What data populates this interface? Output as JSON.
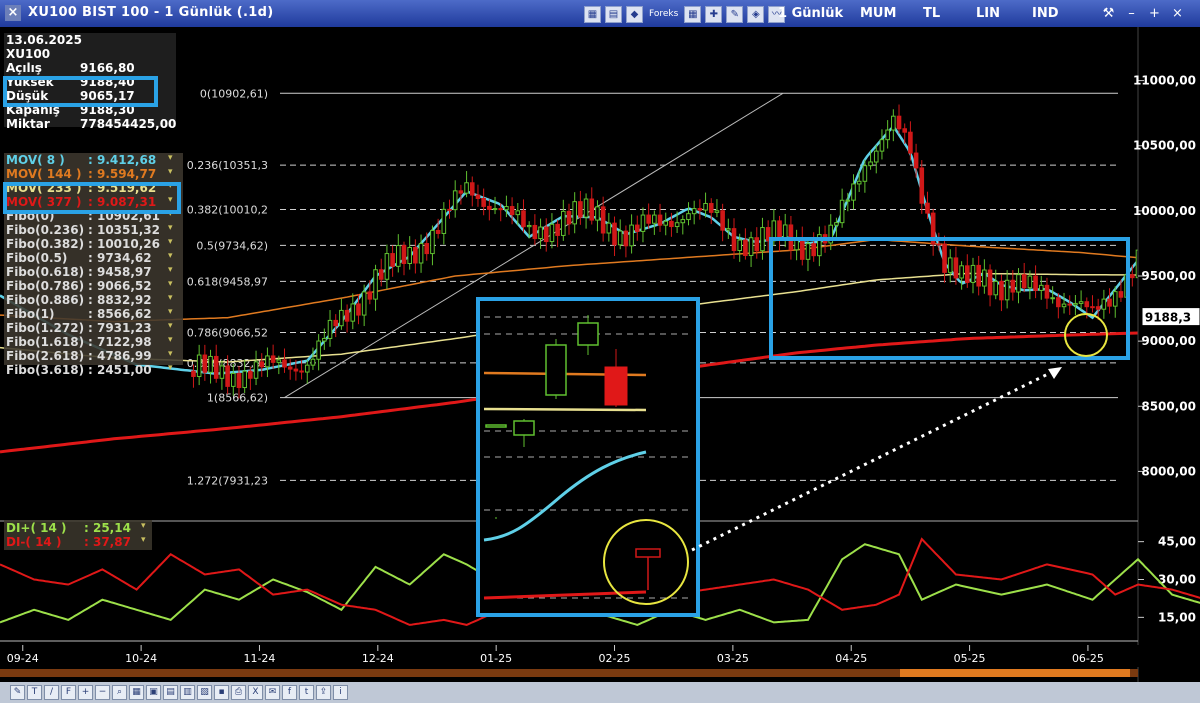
{
  "window": {
    "title": "XU100 BIST 100 - 1 Günlük (.1d)",
    "close_glyph": "×",
    "toolbar": {
      "brand": "Foreks",
      "period_label": "1 Günlük",
      "mum_label": "MUM",
      "tl_label": "TL",
      "lin_label": "LIN",
      "ind_label": "IND"
    },
    "buttons": {
      "minimize": "–",
      "maximize": "+",
      "close": "×"
    }
  },
  "info_panel": {
    "date": "13.06.2025",
    "symbol": "XU100",
    "rows": [
      {
        "label": "Açılış",
        "value": "9166,80"
      },
      {
        "label": "Yüksek",
        "value": "9188,40"
      },
      {
        "label": "Düşük",
        "value": "9065,17"
      },
      {
        "label": "Kapanış",
        "value": "9188,30"
      },
      {
        "label": "Miktar",
        "value": "778454425,00"
      }
    ]
  },
  "indicators": [
    {
      "label": "MOV( 8 )",
      "value": ": 9.412,68",
      "color": "#5fd0e8"
    },
    {
      "label": "MOV( 144 )",
      "value": ": 9.594,77",
      "color": "#e07a20"
    },
    {
      "label": "MOV( 233 )",
      "value": ": 9.519,62",
      "color": "#e8e090"
    },
    {
      "label": "MOV( 377 )",
      "value": ": 9.087,31",
      "color": "#e01818"
    },
    {
      "label": "Fibo(0)",
      "value": ": 10902,61",
      "color": "#dddddd"
    },
    {
      "label": "Fibo(0.236)",
      "value": ": 10351,32",
      "color": "#dddddd"
    },
    {
      "label": "Fibo(0.382)",
      "value": ": 10010,26",
      "color": "#dddddd"
    },
    {
      "label": "Fibo(0.5)",
      "value": ": 9734,62",
      "color": "#dddddd"
    },
    {
      "label": "Fibo(0.618)",
      "value": ": 9458,97",
      "color": "#dddddd"
    },
    {
      "label": "Fibo(0.786)",
      "value": ": 9066,52",
      "color": "#dddddd"
    },
    {
      "label": "Fibo(0.886)",
      "value": ": 8832,92",
      "color": "#dddddd"
    },
    {
      "label": "Fibo(1)",
      "value": ": 8566,62",
      "color": "#dddddd"
    },
    {
      "label": "Fibo(1.272)",
      "value": ": 7931,23",
      "color": "#dddddd"
    },
    {
      "label": "Fibo(1.618)",
      "value": ": 7122,98",
      "color": "#dddddd"
    },
    {
      "label": "Fibo(2.618)",
      "value": ": 4786,99",
      "color": "#dddddd"
    },
    {
      "label": "Fibo(3.618)",
      "value": ": 2451,00",
      "color": "#dddddd"
    }
  ],
  "dropdown_glyph": "▾",
  "di_panel": [
    {
      "label": "DI+( 14 )",
      "value": ": 25,14",
      "color": "#9de04a"
    },
    {
      "label": "DI-( 14 )",
      "value": ": 37,87",
      "color": "#e01818"
    }
  ],
  "chart_data": {
    "type": "candlestick",
    "price_axis": {
      "ticks": [
        11000,
        10500,
        10000,
        9500,
        9000,
        8500,
        8000
      ],
      "tick_labels": [
        "11000,00",
        "10500,00",
        "10000,00",
        "9500,00",
        "9000,00",
        "8500,00",
        "8000,00"
      ],
      "range": [
        7650,
        11350
      ]
    },
    "current_price_label": "9188,3",
    "fib_levels": [
      {
        "value": 10902.61,
        "label": "0(10902,61)"
      },
      {
        "value": 10351.3,
        "label": "0.236(10351,3"
      },
      {
        "value": 10010.2,
        "label": "0.382(10010,2"
      },
      {
        "value": 9734.62,
        "label": "0.5(9734,62)"
      },
      {
        "value": 9458.97,
        "label": "0.618(9458,97"
      },
      {
        "value": 9066.52,
        "label": "0.786(9066,52"
      },
      {
        "value": 8832.92,
        "label": "0.886(8832,92"
      },
      {
        "value": 8566.62,
        "label": "1(8566,62)"
      },
      {
        "value": 7931.23,
        "label": "1.272(7931,23"
      }
    ],
    "date_axis": {
      "labels": [
        "09-24",
        "10-24",
        "11-24",
        "12-24",
        "01-25",
        "02-25",
        "03-25",
        "04-25",
        "05-25",
        "06-25"
      ],
      "range_days": [
        0,
        1000
      ]
    },
    "di_axis": {
      "ticks": [
        45,
        30,
        15
      ],
      "tick_labels": [
        "45,00",
        "30,00",
        "15,00"
      ],
      "range": [
        8,
        52
      ]
    },
    "ma_colors": {
      "mov8": "#5fd0e8",
      "mov144": "#e07a20",
      "mov233": "#e8e090",
      "mov377": "#e01818"
    },
    "series_anchors": {
      "mov8": [
        [
          0,
          9350
        ],
        [
          60,
          9050
        ],
        [
          120,
          8820
        ],
        [
          190,
          8750
        ],
        [
          230,
          8780
        ],
        [
          270,
          8850
        ],
        [
          300,
          9150
        ],
        [
          330,
          9500
        ],
        [
          360,
          9650
        ],
        [
          385,
          9900
        ],
        [
          410,
          10150
        ],
        [
          440,
          10050
        ],
        [
          465,
          9800
        ],
        [
          495,
          9960
        ],
        [
          525,
          9950
        ],
        [
          550,
          9820
        ],
        [
          580,
          9900
        ],
        [
          605,
          10020
        ],
        [
          625,
          9950
        ],
        [
          645,
          9800
        ],
        [
          665,
          9760
        ],
        [
          690,
          9800
        ],
        [
          710,
          9750
        ],
        [
          730,
          9780
        ],
        [
          760,
          10400
        ],
        [
          785,
          10650
        ],
        [
          800,
          10450
        ],
        [
          815,
          10000
        ],
        [
          830,
          9600
        ],
        [
          845,
          9440
        ],
        [
          865,
          9520
        ],
        [
          880,
          9430
        ],
        [
          900,
          9390
        ],
        [
          920,
          9400
        ],
        [
          940,
          9300
        ],
        [
          960,
          9180
        ],
        [
          980,
          9400
        ],
        [
          1000,
          9620
        ],
        [
          1010,
          9580
        ],
        [
          1030,
          9380
        ],
        [
          1050,
          9200
        ],
        [
          1070,
          9300
        ],
        [
          1090,
          9420
        ]
      ],
      "mov144": [
        [
          0,
          9200
        ],
        [
          100,
          9150
        ],
        [
          200,
          9180
        ],
        [
          300,
          9330
        ],
        [
          400,
          9500
        ],
        [
          500,
          9580
        ],
        [
          600,
          9640
        ],
        [
          700,
          9700
        ],
        [
          770,
          9780
        ],
        [
          850,
          9730
        ],
        [
          950,
          9680
        ],
        [
          1050,
          9600
        ],
        [
          1090,
          9594
        ]
      ],
      "mov233": [
        [
          0,
          8950
        ],
        [
          100,
          8870
        ],
        [
          200,
          8840
        ],
        [
          300,
          8900
        ],
        [
          400,
          9020
        ],
        [
          500,
          9150
        ],
        [
          600,
          9270
        ],
        [
          700,
          9380
        ],
        [
          770,
          9470
        ],
        [
          850,
          9520
        ],
        [
          950,
          9510
        ],
        [
          1050,
          9505
        ],
        [
          1090,
          9519
        ]
      ],
      "mov377": [
        [
          0,
          8150
        ],
        [
          100,
          8250
        ],
        [
          200,
          8330
        ],
        [
          300,
          8420
        ],
        [
          400,
          8530
        ],
        [
          500,
          8660
        ],
        [
          600,
          8790
        ],
        [
          700,
          8910
        ],
        [
          770,
          8970
        ],
        [
          850,
          9020
        ],
        [
          950,
          9050
        ],
        [
          1050,
          9075
        ],
        [
          1090,
          9087
        ]
      ],
      "di_plus": [
        [
          0,
          13
        ],
        [
          30,
          18
        ],
        [
          60,
          14
        ],
        [
          90,
          22
        ],
        [
          120,
          18
        ],
        [
          150,
          14
        ],
        [
          180,
          26
        ],
        [
          210,
          22
        ],
        [
          240,
          30
        ],
        [
          270,
          25
        ],
        [
          300,
          18
        ],
        [
          330,
          35
        ],
        [
          360,
          28
        ],
        [
          390,
          40
        ],
        [
          410,
          36
        ],
        [
          440,
          28
        ],
        [
          470,
          30
        ],
        [
          500,
          22
        ],
        [
          530,
          16
        ],
        [
          560,
          12
        ],
        [
          590,
          18
        ],
        [
          620,
          14
        ],
        [
          650,
          18
        ],
        [
          680,
          13
        ],
        [
          710,
          14
        ],
        [
          740,
          38
        ],
        [
          760,
          44
        ],
        [
          790,
          40
        ],
        [
          810,
          22
        ],
        [
          840,
          28
        ],
        [
          880,
          24
        ],
        [
          920,
          28
        ],
        [
          960,
          22
        ],
        [
          980,
          30
        ],
        [
          1000,
          38
        ],
        [
          1030,
          24
        ],
        [
          1060,
          20
        ],
        [
          1080,
          32
        ],
        [
          1095,
          25
        ]
      ],
      "di_minus": [
        [
          0,
          36
        ],
        [
          30,
          30
        ],
        [
          60,
          28
        ],
        [
          90,
          34
        ],
        [
          120,
          26
        ],
        [
          150,
          40
        ],
        [
          180,
          32
        ],
        [
          210,
          34
        ],
        [
          240,
          24
        ],
        [
          270,
          26
        ],
        [
          300,
          20
        ],
        [
          330,
          18
        ],
        [
          360,
          12
        ],
        [
          390,
          14
        ],
        [
          410,
          12
        ],
        [
          440,
          18
        ],
        [
          470,
          26
        ],
        [
          500,
          20
        ],
        [
          530,
          30
        ],
        [
          560,
          24
        ],
        [
          590,
          24
        ],
        [
          620,
          26
        ],
        [
          650,
          28
        ],
        [
          680,
          30
        ],
        [
          710,
          26
        ],
        [
          740,
          18
        ],
        [
          770,
          20
        ],
        [
          790,
          24
        ],
        [
          810,
          46
        ],
        [
          840,
          32
        ],
        [
          880,
          30
        ],
        [
          920,
          36
        ],
        [
          960,
          32
        ],
        [
          980,
          24
        ],
        [
          1000,
          28
        ],
        [
          1030,
          26
        ],
        [
          1060,
          22
        ],
        [
          1080,
          26
        ],
        [
          1095,
          38
        ]
      ]
    }
  }
}
